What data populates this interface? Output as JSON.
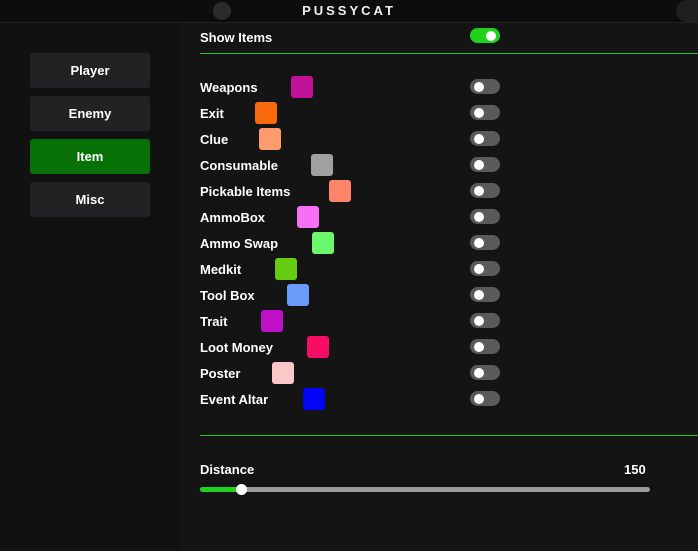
{
  "window": {
    "title": "PUSSYCAT"
  },
  "sidebar": {
    "items": [
      {
        "label": "Player",
        "active": false
      },
      {
        "label": "Enemy",
        "active": false
      },
      {
        "label": "Item",
        "active": true
      },
      {
        "label": "Misc",
        "active": false
      }
    ]
  },
  "show_items": {
    "label": "Show Items",
    "enabled": true
  },
  "items": [
    {
      "label": "Weapons",
      "color": "#c4119a",
      "enabled": false
    },
    {
      "label": "Exit",
      "color": "#f86a0d",
      "enabled": false
    },
    {
      "label": "Clue",
      "color": "#fd9b6c",
      "enabled": false
    },
    {
      "label": "Consumable",
      "color": "#a0a0a0",
      "enabled": false
    },
    {
      "label": "Pickable Items",
      "color": "#fb8469",
      "enabled": false
    },
    {
      "label": "AmmoBox",
      "color": "#f76ef7",
      "enabled": false
    },
    {
      "label": "Ammo Swap",
      "color": "#6cf86c",
      "enabled": false
    },
    {
      "label": "Medkit",
      "color": "#66cc0f",
      "enabled": false
    },
    {
      "label": "Tool Box",
      "color": "#6a9bf8",
      "enabled": false
    },
    {
      "label": "Trait",
      "color": "#c00fc9",
      "enabled": false
    },
    {
      "label": "Loot Money",
      "color": "#f70c66",
      "enabled": false
    },
    {
      "label": "Poster",
      "color": "#fdc7c7",
      "enabled": false
    },
    {
      "label": "Event Altar",
      "color": "#0505f5",
      "enabled": false
    }
  ],
  "distance": {
    "label": "Distance",
    "value": "150",
    "fraction": 0.09
  }
}
